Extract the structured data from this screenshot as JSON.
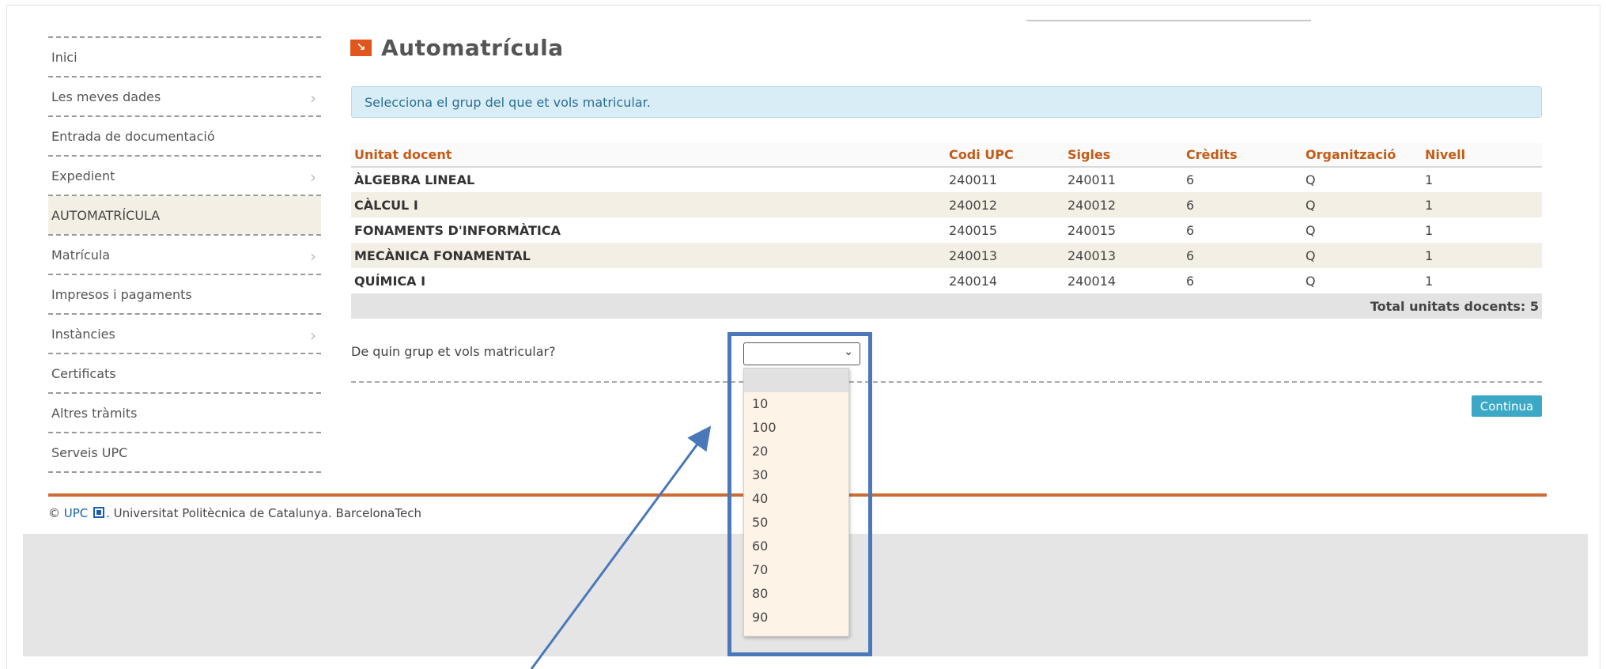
{
  "sidebar": {
    "items": [
      {
        "label": "Inici",
        "has_submenu": false,
        "active": false
      },
      {
        "label": "Les meves dades",
        "has_submenu": true,
        "active": false
      },
      {
        "label": "Entrada de documentació",
        "has_submenu": false,
        "active": false
      },
      {
        "label": "Expedient",
        "has_submenu": true,
        "active": false
      },
      {
        "label": "AUTOMATRÍCULA",
        "has_submenu": false,
        "active": true
      },
      {
        "label": "Matrícula",
        "has_submenu": true,
        "active": false
      },
      {
        "label": "Impresos i pagaments",
        "has_submenu": false,
        "active": false
      },
      {
        "label": "Instàncies",
        "has_submenu": true,
        "active": false
      },
      {
        "label": "Certificats",
        "has_submenu": false,
        "active": false
      },
      {
        "label": "Altres tràmits",
        "has_submenu": false,
        "active": false
      },
      {
        "label": "Serveis UPC",
        "has_submenu": false,
        "active": false
      }
    ]
  },
  "page": {
    "title": "Automatrícula",
    "icon": "arrow-box-icon",
    "info": "Selecciona el grup del que et vols matricular."
  },
  "table": {
    "headers": [
      "Unitat docent",
      "Codi UPC",
      "Sigles",
      "Crèdits",
      "Organització",
      "Nivell"
    ],
    "rows": [
      [
        "ÀLGEBRA LINEAL",
        "240011",
        "240011",
        "6",
        "Q",
        "1"
      ],
      [
        "CÀLCUL I",
        "240012",
        "240012",
        "6",
        "Q",
        "1"
      ],
      [
        "FONAMENTS D'INFORMÀTICA",
        "240015",
        "240015",
        "6",
        "Q",
        "1"
      ],
      [
        "MECÀNICA FONAMENTAL",
        "240013",
        "240013",
        "6",
        "Q",
        "1"
      ],
      [
        "QUÍMICA I",
        "240014",
        "240014",
        "6",
        "Q",
        "1"
      ]
    ],
    "total": "Total unitats docents: 5"
  },
  "form": {
    "question": "De quin grup et vols matricular?",
    "selected_value": "",
    "options": [
      "",
      "10",
      "100",
      "20",
      "30",
      "40",
      "50",
      "60",
      "70",
      "80",
      "90"
    ],
    "continue_label": "Continua"
  },
  "footer": {
    "copyright": "©",
    "upc_link": "UPC",
    "text": ". Universitat Politècnica de Catalunya. BarcelonaTech"
  },
  "colors": {
    "accent_orange": "#c45b17",
    "info_bg": "#d9edf6",
    "button_blue": "#3ba8c6",
    "annotation_blue": "#4a78b9"
  }
}
